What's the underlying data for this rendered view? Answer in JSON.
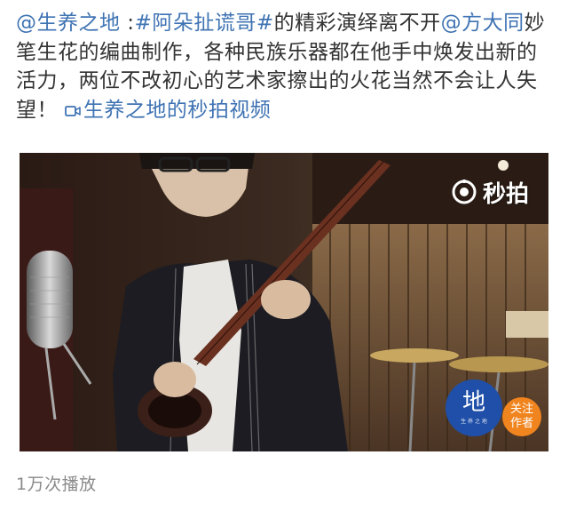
{
  "post": {
    "author_mention": "@生养之地",
    "separator": " :",
    "hashtag": "#阿朵扯谎哥#",
    "text_1": "的精彩演绎离不开",
    "artist_mention": "@方大同",
    "text_2": "妙笔生花的编曲制作，各种民族乐器都在他手中焕发出新的活力，两位不改初心的艺术家擦出的火花当然不会让人失望！",
    "video_link_label": "生养之地的秒拍视频"
  },
  "video": {
    "watermark": "秒拍",
    "channel_logo_char": "地",
    "channel_logo_sub": "生 养 之 地",
    "follow_line1": "关注",
    "follow_line2": "作者"
  },
  "stats": {
    "play_count": "1万次播放"
  },
  "colors": {
    "link": "#3f73b3",
    "follow_badge": "#f0841e",
    "channel_logo": "#1f4fa8"
  }
}
